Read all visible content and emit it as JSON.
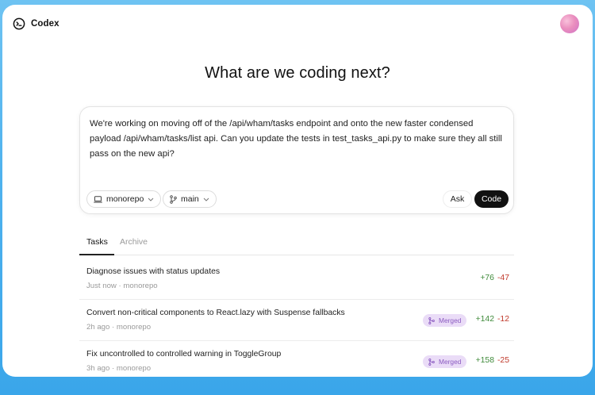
{
  "app": {
    "name": "Codex"
  },
  "headline": "What are we coding next?",
  "composer": {
    "prompt": "We're working on moving off of the /api/wham/tasks endpoint and onto the new faster condensed payload /api/wham/tasks/list api. Can you update the tests in test_tasks_api.py to make sure they all still pass on the new api?",
    "repo": "monorepo",
    "branch": "main",
    "ask_label": "Ask",
    "code_label": "Code"
  },
  "tabs": [
    "Tasks",
    "Archive"
  ],
  "tasks": [
    {
      "title": "Diagnose issues with status updates",
      "time": "Just now",
      "repo": "monorepo",
      "separator": "·",
      "status": "",
      "added": "+76",
      "removed": "-47"
    },
    {
      "title": "Convert non-critical components to React.lazy with Suspense fallbacks",
      "time": "2h ago",
      "repo": "monorepo",
      "separator": "·",
      "status": "Merged",
      "added": "+142",
      "removed": "-12"
    },
    {
      "title": "Fix uncontrolled to controlled warning in ToggleGroup",
      "time": "3h ago",
      "repo": "monorepo",
      "separator": "·",
      "status": "Merged",
      "added": "+158",
      "removed": "-25"
    }
  ],
  "icons": {
    "logo": "codex-logo-icon",
    "repo": "laptop-icon",
    "branch": "git-branch-icon",
    "dropdown": "chevron-down-icon",
    "merged": "git-merge-icon"
  },
  "colors": {
    "accent_dark": "#111111",
    "merged_badge_bg": "#eadcf7",
    "merged_badge_text": "#8b5bc1",
    "additions": "#3f8a3a",
    "deletions": "#c0392b",
    "backdrop": "#4fb2ee"
  }
}
